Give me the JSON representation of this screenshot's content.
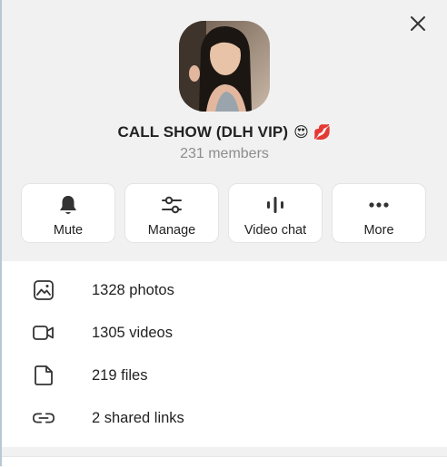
{
  "profile": {
    "title": "CALL SHOW (DLH VIP)",
    "emoji": "😍 💋",
    "members": "231 members"
  },
  "actions": [
    {
      "label": "Mute",
      "icon": "bell-icon"
    },
    {
      "label": "Manage",
      "icon": "sliders-icon"
    },
    {
      "label": "Video chat",
      "icon": "voice-bars-icon"
    },
    {
      "label": "More",
      "icon": "dots-icon"
    }
  ],
  "media": [
    {
      "label": "1328 photos",
      "icon": "photo-icon"
    },
    {
      "label": "1305 videos",
      "icon": "video-icon"
    },
    {
      "label": "219 files",
      "icon": "file-icon"
    },
    {
      "label": "2 shared links",
      "icon": "link-icon"
    }
  ],
  "colors": {
    "panel_bg": "#f1f1f1",
    "card_bg": "#ffffff",
    "text": "#222222",
    "muted": "#8d8d8d"
  }
}
